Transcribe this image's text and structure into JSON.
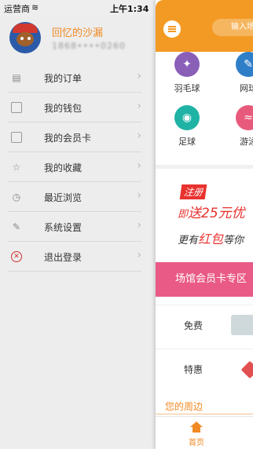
{
  "status": {
    "carrier": "运营商",
    "wifi": "≋",
    "time": "上午1:34"
  },
  "drawer": {
    "username": "回忆的沙漏",
    "phone": "1868••••0260",
    "menu": [
      {
        "label": "我的订单",
        "icon": "order-icon"
      },
      {
        "label": "我的钱包",
        "icon": "wallet-icon"
      },
      {
        "label": "我的会员卡",
        "icon": "member-card-icon"
      },
      {
        "label": "我的收藏",
        "icon": "star-icon"
      },
      {
        "label": "最近浏览",
        "icon": "clock-icon"
      },
      {
        "label": "系统设置",
        "icon": "wrench-icon"
      },
      {
        "label": "退出登录",
        "icon": "logout-icon"
      }
    ]
  },
  "main": {
    "search_placeholder": "输入场",
    "sports": [
      {
        "label": "羽毛球",
        "color": "#8a5fb8"
      },
      {
        "label": "网球",
        "color": "#2f7fc8"
      },
      {
        "label": "足球",
        "color": "#1fb3a5"
      },
      {
        "label": "游泳",
        "color": "#e85a7c"
      }
    ],
    "promo": {
      "tag": "注册",
      "line1_prefix": "即",
      "line1": "送25元优",
      "line2_a": "更有",
      "line2_b": "红包",
      "line2_c": "等你"
    },
    "card_zone": "场馆会员卡专区",
    "rows": [
      {
        "label": "免费"
      },
      {
        "label": "特惠"
      }
    ],
    "nearby": "您的周边",
    "tab_home": "首页"
  },
  "colors": {
    "accent": "#f39a25",
    "pink": "#ea5a86",
    "red": "#e8322e"
  }
}
